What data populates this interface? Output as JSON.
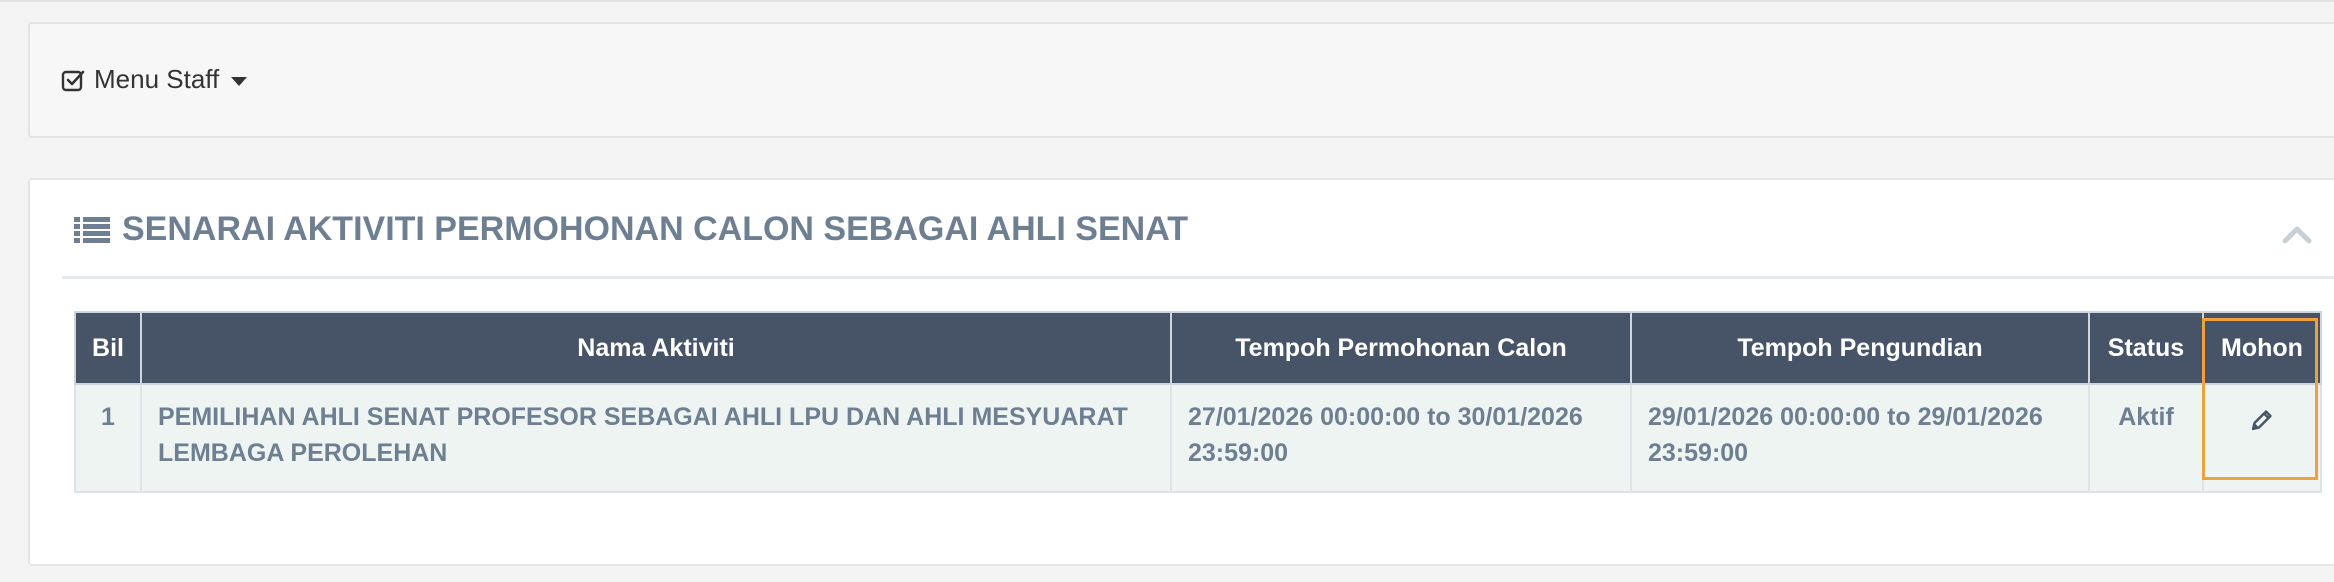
{
  "menu": {
    "label": "Menu Staff",
    "icon": "check-square-icon"
  },
  "panel": {
    "title": "SENARAI AKTIVITI PERMOHONAN CALON SEBAGAI AHLI SENAT",
    "title_icon": "list-icon",
    "collapse_icon": "chevron-up-icon"
  },
  "table": {
    "headers": {
      "bil": "Bil",
      "nama": "Nama Aktiviti",
      "tempoh_permohonan": "Tempoh Permohonan Calon",
      "tempoh_pengundian": "Tempoh Pengundian",
      "status": "Status",
      "mohon": "Mohon"
    },
    "rows": [
      {
        "bil": "1",
        "nama": "PEMILIHAN AHLI SENAT PROFESOR SEBAGAI AHLI LPU DAN AHLI MESYUARAT LEMBAGA PEROLEHAN",
        "tempoh_permohonan": "27/01/2026 00:00:00 to 30/01/2026 23:59:00",
        "tempoh_pengundian": "29/01/2026 00:00:00 to 29/01/2026 23:59:00",
        "status": "Aktif",
        "mohon_icon": "pencil-icon"
      }
    ]
  },
  "colors": {
    "header_bg": "#475467",
    "row_bg": "#eef4f1",
    "title_text": "#6e7f91",
    "highlight": "#f0a03c"
  }
}
